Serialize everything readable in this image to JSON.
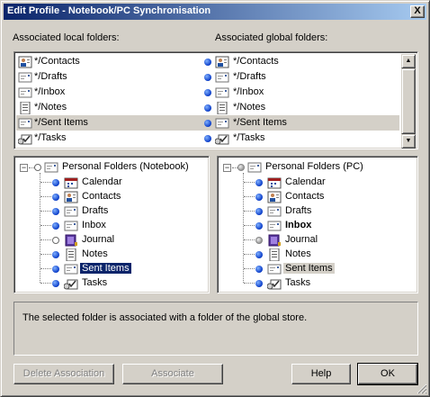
{
  "window": {
    "title": "Edit Profile - Notebook/PC Synchronisation",
    "close_label": "X"
  },
  "labels": {
    "local_folders": "Associated local folders:",
    "global_folders": "Associated global folders:"
  },
  "associations": [
    {
      "local": "*/Contacts",
      "global": "*/Contacts",
      "icon": "contacts-icon",
      "selected": false
    },
    {
      "local": "*/Drafts",
      "global": "*/Drafts",
      "icon": "mail-folder-icon",
      "selected": false
    },
    {
      "local": "*/Inbox",
      "global": "*/Inbox",
      "icon": "mail-folder-icon",
      "selected": false
    },
    {
      "local": "*/Notes",
      "global": "*/Notes",
      "icon": "notes-icon",
      "selected": false
    },
    {
      "local": "*/Sent Items",
      "global": "*/Sent Items",
      "icon": "mail-folder-icon",
      "selected": true
    },
    {
      "local": "*/Tasks",
      "global": "*/Tasks",
      "icon": "tasks-icon",
      "selected": false
    }
  ],
  "tree_local": {
    "root": "Personal Folders (Notebook)",
    "items": [
      {
        "label": "Calendar",
        "icon": "calendar-icon",
        "state": "assoc"
      },
      {
        "label": "Contacts",
        "icon": "contacts-icon",
        "state": "assoc"
      },
      {
        "label": "Drafts",
        "icon": "mail-folder-icon",
        "state": "assoc"
      },
      {
        "label": "Inbox",
        "icon": "mail-folder-icon",
        "state": "assoc"
      },
      {
        "label": "Journal",
        "icon": "journal-icon",
        "state": "none"
      },
      {
        "label": "Notes",
        "icon": "notes-icon",
        "state": "assoc"
      },
      {
        "label": "Sent Items",
        "icon": "mail-folder-icon",
        "state": "assoc"
      },
      {
        "label": "Tasks",
        "icon": "tasks-icon",
        "state": "assoc"
      }
    ]
  },
  "tree_global": {
    "root": "Personal Folders (PC)",
    "items": [
      {
        "label": "Calendar",
        "icon": "calendar-icon",
        "state": "assoc"
      },
      {
        "label": "Contacts",
        "icon": "contacts-icon",
        "state": "assoc"
      },
      {
        "label": "Drafts",
        "icon": "mail-folder-icon",
        "state": "assoc"
      },
      {
        "label": "Inbox",
        "icon": "mail-folder-icon",
        "state": "assoc"
      },
      {
        "label": "Journal",
        "icon": "journal-icon",
        "state": "grey"
      },
      {
        "label": "Notes",
        "icon": "notes-icon",
        "state": "assoc"
      },
      {
        "label": "Sent Items",
        "icon": "mail-folder-icon",
        "state": "assoc"
      },
      {
        "label": "Tasks",
        "icon": "tasks-icon",
        "state": "assoc"
      }
    ]
  },
  "status_text": "The selected folder is associated with a folder of the global store.",
  "buttons": {
    "delete_association": "Delete Association",
    "associate": "Associate",
    "help": "Help",
    "ok": "OK"
  },
  "colors": {
    "title_start": "#0a246a",
    "title_end": "#a6caf0",
    "dot_blue": "#0a3cc8",
    "face": "#d4d0c8"
  }
}
